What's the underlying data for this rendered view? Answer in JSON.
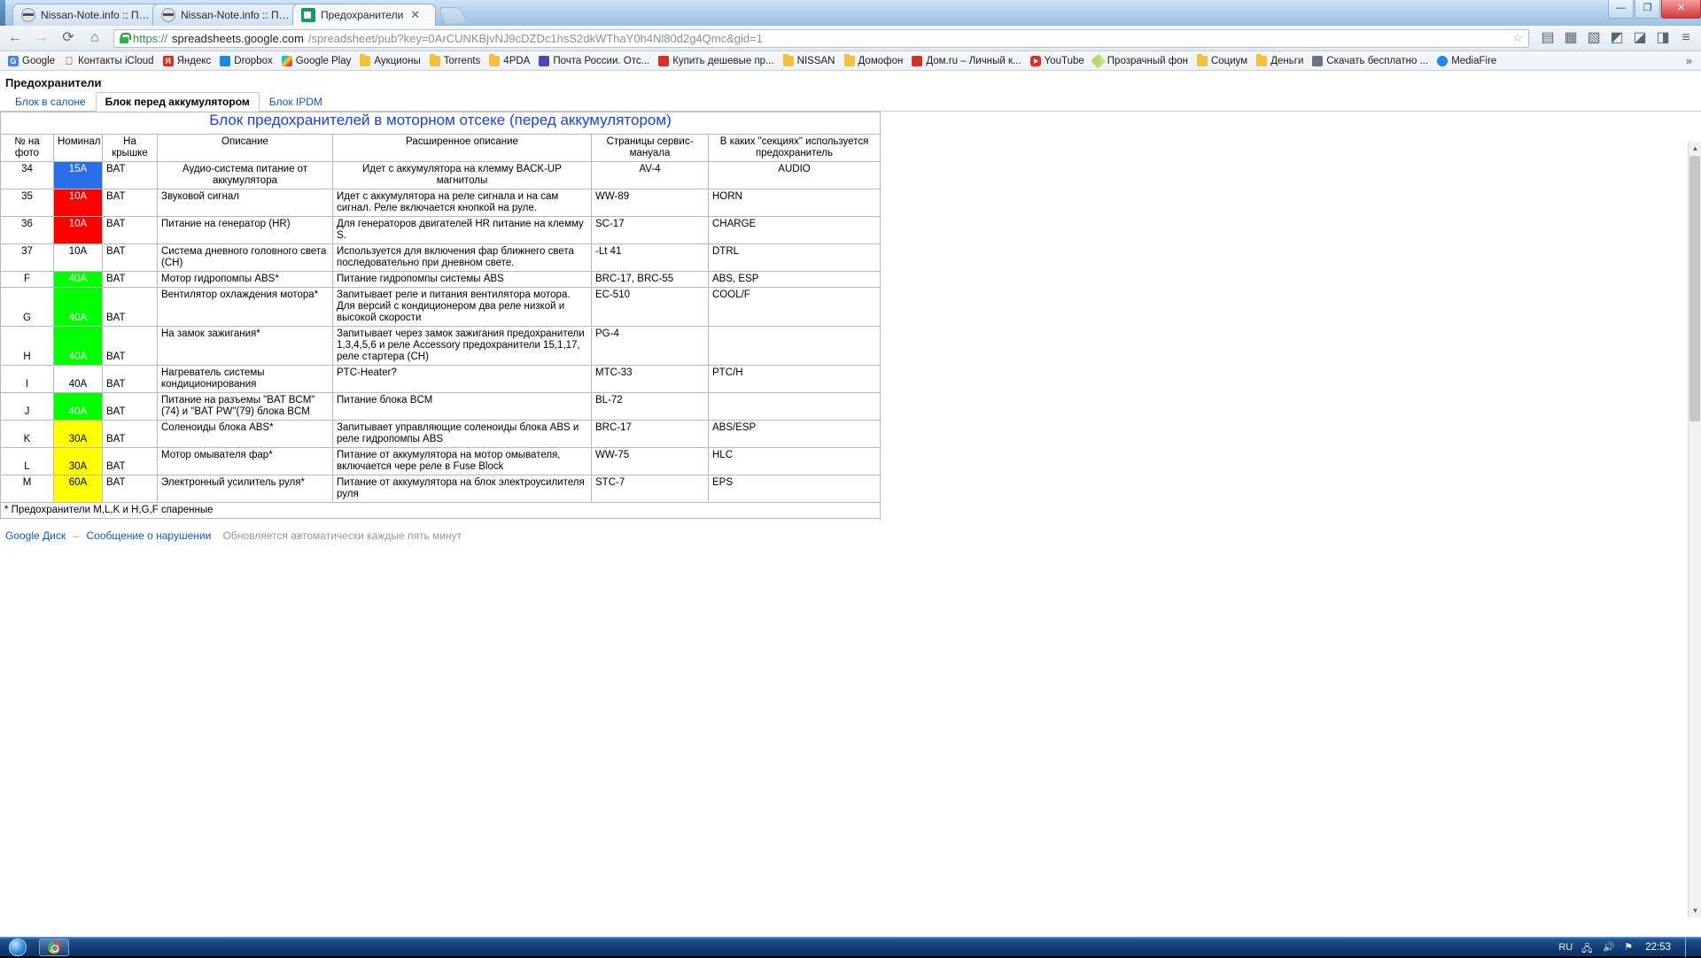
{
  "browser": {
    "tabs": [
      {
        "title": "Nissan-Note.info :: Поиск",
        "icon": "nissan-favicon",
        "active": false
      },
      {
        "title": "Nissan-Note.info :: Просм",
        "icon": "nissan-favicon",
        "active": false
      },
      {
        "title": "Предохранители",
        "icon": "google-sheets-favicon",
        "active": true
      }
    ],
    "close_label": "✕",
    "nav": {
      "back": "←",
      "forward": "→",
      "reload": "⟳",
      "home": "⌂"
    },
    "omnibox": {
      "scheme": "https://",
      "host": "spreadsheets.google.com",
      "path": "/spreadsheet/pub?key=0ArCUNKBjvNJ9cDZDc1hsS2dkWThaY0h4Nl80d2g4Qmc&gid=1",
      "lock_icon": "lock-icon"
    },
    "window_controls": {
      "minimize": "—",
      "maximize": "❐",
      "close": "✕"
    },
    "bookmarks": [
      {
        "label": "Google",
        "icon": "google-icon"
      },
      {
        "label": "Контакты iCloud",
        "icon": "apple-icon"
      },
      {
        "label": "Яндекс",
        "icon": "yandex-icon"
      },
      {
        "label": "Dropbox",
        "icon": "dropbox-icon"
      },
      {
        "label": "Google Play",
        "icon": "google-play-icon"
      },
      {
        "label": "Аукционы",
        "icon": "folder-icon"
      },
      {
        "label": "Torrents",
        "icon": "folder-icon"
      },
      {
        "label": "4PDA",
        "icon": "mail-icon"
      },
      {
        "label": "Почта России. Отс...",
        "icon": "mail-icon"
      },
      {
        "label": "Купить дешевые пр...",
        "icon": "red-icon"
      },
      {
        "label": "NISSAN",
        "icon": "folder-icon"
      },
      {
        "label": "Домофон",
        "icon": "folder-icon"
      },
      {
        "label": "Дом.ru – Личный к...",
        "icon": "red-icon"
      },
      {
        "label": "YouTube",
        "icon": "youtube-icon"
      },
      {
        "label": "Прозрачный фон",
        "icon": "pen-icon"
      },
      {
        "label": "Социум",
        "icon": "folder-icon"
      },
      {
        "label": "Деньги",
        "icon": "folder-icon"
      },
      {
        "label": "Скачать бесплатно ...",
        "icon": "speaker-icon"
      },
      {
        "label": "MediaFire",
        "icon": "mediafire-icon"
      }
    ],
    "bookmarks_overflow": "»"
  },
  "sheet": {
    "document_title": "Предохранители",
    "tabs": [
      {
        "label": "Блок в салоне",
        "active": false
      },
      {
        "label": "Блок перед аккумулятором",
        "active": true
      },
      {
        "label": "Блок IPDM",
        "active": false
      }
    ],
    "banner": "Блок предохранителей в моторном отсеке (перед аккумулятором)",
    "headers": [
      "№ на фото",
      "Номинал",
      "На крышке",
      "Описание",
      "Расширенное описание",
      "Страницы сервис-мануала",
      "В каких \"секциях\" используется предохранитель"
    ],
    "rows": [
      {
        "num": "34",
        "rating": "15A",
        "rating_color": "#2a6fe8",
        "rating_text_color": "#ffffff",
        "cap": "BAT",
        "desc": "Аудио-система питание от аккумулятора",
        "desc_align": "center",
        "ext": "Идет с аккумулятора на клемму BACK-UP магнитолы",
        "ext_align": "center",
        "pages": "AV-4",
        "pages_align": "center",
        "section": "AUDIO",
        "section_align": "center"
      },
      {
        "num": "35",
        "rating": "10A",
        "rating_color": "#fe0000",
        "rating_text_color": "#ffffff",
        "cap": "BAT",
        "desc": "Звуковой сигнал",
        "ext": "Идет с аккумулятора на реле сигнала и на сам сигнал. Реле включается кнопкой на руле.",
        "pages": "WW-89",
        "section": "HORN"
      },
      {
        "num": "36",
        "rating": "10A",
        "rating_color": "#fe0000",
        "rating_text_color": "#ffffff",
        "cap": "BAT",
        "desc": "Питание на генератор (HR)",
        "ext": "Для генераторов двигателей HR питание на клемму S.",
        "pages": "SC-17",
        "section": "CHARGE"
      },
      {
        "num": "37",
        "rating": "10A",
        "rating_color": "",
        "rating_text_color": "#000000",
        "cap": "BAT",
        "desc": "Система дневного головного света (CH)",
        "ext": "Используется для включения фар ближнего света последовательно при дневном свете.",
        "pages": "-Lt 41",
        "section": "DTRL"
      },
      {
        "num": "F",
        "rating": "40A",
        "rating_color": "#00ff00",
        "rating_text_color": "#ffffff",
        "cap": "BAT",
        "desc": "Мотор гидропомпы ABS*",
        "ext": "Питание гидропомпы системы ABS",
        "pages": "BRC-17, BRC-55",
        "section": "ABS, ESP"
      },
      {
        "num": "G",
        "rating": "40A",
        "rating_color": "#00ff00",
        "rating_text_color": "#ffffff",
        "cap": "BAT",
        "desc": "Вентилятор охлаждения мотора*",
        "ext": "Запитывает реле и питания вентилятора мотора. Для версий с кондиционером два реле низкой и высокой скорости",
        "pages": "EC-510",
        "section": "COOL/F"
      },
      {
        "num": "H",
        "rating": "40A",
        "rating_color": "#00ff00",
        "rating_text_color": "#ffffff",
        "cap": "BAT",
        "desc": "На замок зажигания*",
        "ext": "Запитывает через замок зажигания предохранители 1,3,4,5,6 и реле Accessory предохранители 15,1,17, реле стартера (CH)",
        "pages": "PG-4",
        "section": ""
      },
      {
        "num": "I",
        "rating": "40A",
        "rating_color": "",
        "rating_text_color": "#000000",
        "cap": "BAT",
        "desc": "Нагреватель системы кондиционирования",
        "ext": "PTC-Heater?",
        "pages": "MTC-33",
        "section": "PTC/H"
      },
      {
        "num": "J",
        "rating": "40A",
        "rating_color": "#00ff00",
        "rating_text_color": "#ffffff",
        "cap": "BAT",
        "desc": "Питание на разъемы \"BAT BCM\"(74) и \"BAT PW\"(79) блока BCM",
        "ext": "Питание блока BCM",
        "pages": "BL-72",
        "section": ""
      },
      {
        "num": "K",
        "rating": "30A",
        "rating_color": "#ffff00",
        "rating_text_color": "#000000",
        "cap": "BAT",
        "desc": "Соленоиды блока ABS*",
        "ext": "Запитывает управляющие соленоиды блока ABS и реле гидропомпы ABS",
        "pages": "BRC-17",
        "section": "ABS/ESP"
      },
      {
        "num": "L",
        "rating": "30A",
        "rating_color": "#ffff00",
        "rating_text_color": "#000000",
        "cap": "BAT",
        "desc": "Мотор омывателя фар*",
        "ext": "Питание от аккумулятора на мотор омывателя, включается чере реле в Fuse Block",
        "pages": "WW-75",
        "section": "HLC"
      },
      {
        "num": "M",
        "rating": "60A",
        "rating_color": "#ffff00",
        "rating_text_color": "#000000",
        "cap": "BAT",
        "desc": "Электронный усилитель руля*",
        "ext": "Питание от аккумулятора на блок электроусилителя руля",
        "pages": "STC-7",
        "section": "EPS"
      }
    ],
    "footnote": "* Предохранители M,L,K и H,G,F спаренные",
    "footer": {
      "drive_link": "Google Диск",
      "separator": "–",
      "report_link": "Сообщение о нарушении",
      "auto_update": "Обновляется автоматически каждые пять минут"
    }
  },
  "taskbar": {
    "start_label": "start-orb",
    "items": [
      {
        "label": "chrome-taskbar-item",
        "icon": "chrome-icon"
      }
    ],
    "language": "RU",
    "clock": "22:53"
  }
}
